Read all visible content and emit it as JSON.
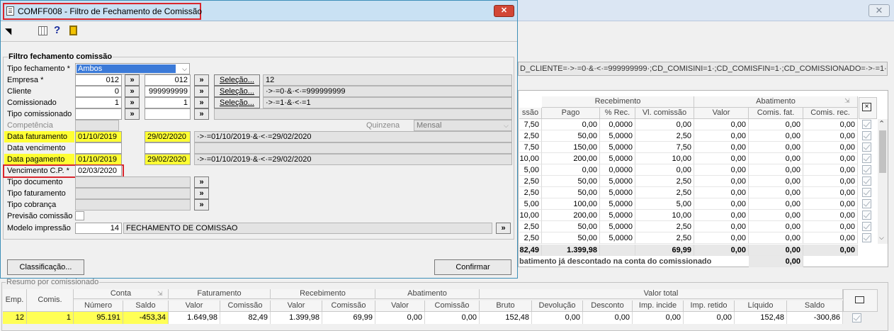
{
  "dialog": {
    "title": "COMFF008 - Filtro de Fechamento de Comissão",
    "close_label": "✕",
    "group_title": "Filtro fechamento comissão",
    "fields": {
      "tipo_fechamento": {
        "label": "Tipo fechamento *",
        "value": "Ambos"
      },
      "empresa": {
        "label": "Empresa *",
        "from": "012",
        "to": "012",
        "selection": "12"
      },
      "cliente": {
        "label": "Cliente",
        "from": "0",
        "to": "999999999",
        "selection": "·>·=0·&·<·=999999999"
      },
      "comissionado": {
        "label": "Comissionado",
        "from": "1",
        "to": "1",
        "selection": "·>·=1·&·<·=1"
      },
      "tipo_comissionado": {
        "label": "Tipo comissionado"
      },
      "competencia": {
        "label": "Competência",
        "quinzena_label": "Quinzena",
        "quinzena_value": "Mensal"
      },
      "data_faturamento": {
        "label": "Data faturamento",
        "from": "01/10/2019",
        "to": "29/02/2020",
        "selection": "·>·=01/10/2019·&·<·=29/02/2020"
      },
      "data_vencimento": {
        "label": "Data vencimento"
      },
      "data_pagamento": {
        "label": "Data pagamento",
        "from": "01/10/2019",
        "to": "29/02/2020",
        "selection": "·>·=01/10/2019·&·<·=29/02/2020"
      },
      "vencimento_cp": {
        "label": "Vencimento C.P. *",
        "value": "02/03/2020"
      },
      "tipo_documento": {
        "label": "Tipo documento"
      },
      "tipo_faturamento": {
        "label": "Tipo faturamento"
      },
      "tipo_cobranca": {
        "label": "Tipo cobrança"
      },
      "previsao_comissao": {
        "label": "Previsão comissão"
      },
      "modelo_impressao": {
        "label": "Modelo impressão",
        "code": "14",
        "name": "FECHAMENTO DE COMISSAO"
      }
    },
    "selecao_label": "Seleção...",
    "arrow_label": "»",
    "classificacao_label": "Classificação...",
    "confirmar_label": "Confirmar"
  },
  "background": {
    "close_label": "✕",
    "filter_text": "D_CLIENTE=·>·=0·&·<·=999999999·;CD_COMISINI=1·;CD_COMISFIN=1·;CD_COMISSIONADO=·>·=1·&·<·=1·;",
    "grid": {
      "group_headers": [
        "Recebimento",
        "Abatimento"
      ],
      "columns": [
        "ssão",
        "Pago",
        "% Rec.",
        "Vl. comissão",
        "Valor",
        "Comis. fat.",
        "Comis. rec."
      ],
      "rows": [
        [
          "7,50",
          "0,00",
          "0,0000",
          "0,00",
          "0,00",
          "0,00",
          "0,00"
        ],
        [
          "2,50",
          "50,00",
          "5,0000",
          "2,50",
          "0,00",
          "0,00",
          "0,00"
        ],
        [
          "7,50",
          "150,00",
          "5,0000",
          "7,50",
          "0,00",
          "0,00",
          "0,00"
        ],
        [
          "10,00",
          "200,00",
          "5,0000",
          "10,00",
          "0,00",
          "0,00",
          "0,00"
        ],
        [
          "5,00",
          "0,00",
          "0,0000",
          "0,00",
          "0,00",
          "0,00",
          "0,00"
        ],
        [
          "2,50",
          "50,00",
          "5,0000",
          "2,50",
          "0,00",
          "0,00",
          "0,00"
        ],
        [
          "2,50",
          "50,00",
          "5,0000",
          "2,50",
          "0,00",
          "0,00",
          "0,00"
        ],
        [
          "5,00",
          "100,00",
          "5,0000",
          "5,00",
          "0,00",
          "0,00",
          "0,00"
        ],
        [
          "10,00",
          "200,00",
          "5,0000",
          "10,00",
          "0,00",
          "0,00",
          "0,00"
        ],
        [
          "2,50",
          "50,00",
          "5,0000",
          "2,50",
          "0,00",
          "0,00",
          "0,00"
        ],
        [
          "2,50",
          "50,00",
          "5,0000",
          "2,50",
          "0,00",
          "0,00",
          "0,00"
        ]
      ],
      "totals": [
        "82,49",
        "1.399,98",
        "",
        "69,99",
        "0,00",
        "0,00",
        "0,00"
      ],
      "note": "batimento já descontado na conta do comissionado",
      "note_value": "0,00"
    },
    "summary": {
      "title": "Resumo por comissionado",
      "group_headers": [
        "Conta",
        "Faturamento",
        "Recebimento",
        "Abatimento",
        "Valor total"
      ],
      "columns": [
        "Emp.",
        "Comis.",
        "Número",
        "Saldo",
        "Valor",
        "Comissão",
        "Valor",
        "Comissão",
        "Valor",
        "Comissão",
        "Bruto",
        "Devolução",
        "Desconto",
        "Imp. incide",
        "Imp. retido",
        "Líquido",
        "Saldo"
      ],
      "row": [
        "12",
        "1",
        "95.191",
        "-453,34",
        "1.649,98",
        "82,49",
        "1.399,98",
        "69,99",
        "0,00",
        "0,00",
        "152,48",
        "0,00",
        "0,00",
        "0,00",
        "0,00",
        "152,48",
        "-300,86"
      ]
    }
  }
}
